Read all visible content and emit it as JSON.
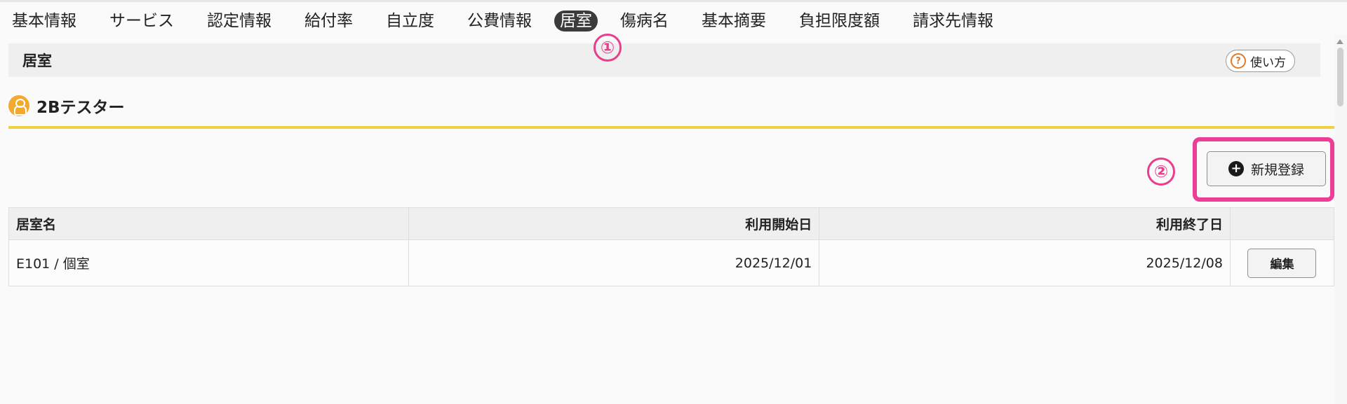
{
  "tabs": [
    {
      "label": "基本情報",
      "active": false
    },
    {
      "label": "サービス",
      "active": false
    },
    {
      "label": "認定情報",
      "active": false
    },
    {
      "label": "給付率",
      "active": false
    },
    {
      "label": "自立度",
      "active": false
    },
    {
      "label": "公費情報",
      "active": false
    },
    {
      "label": "居室",
      "active": true
    },
    {
      "label": "傷病名",
      "active": false
    },
    {
      "label": "基本摘要",
      "active": false
    },
    {
      "label": "負担限度額",
      "active": false
    },
    {
      "label": "請求先情報",
      "active": false
    }
  ],
  "annotations": {
    "one": "①",
    "two": "②"
  },
  "section": {
    "title": "居室",
    "help_label": "使い方",
    "help_icon": "question-icon"
  },
  "user": {
    "name": "2Bテスター",
    "icon": "person-icon"
  },
  "actions": {
    "new_label": "新規登録",
    "new_icon": "plus-circle-icon"
  },
  "table": {
    "headers": [
      "居室名",
      "利用開始日",
      "利用終了日",
      ""
    ],
    "rows": [
      {
        "room": "E101 / 個室",
        "start": "2025/12/01",
        "end": "2025/12/08",
        "edit_label": "編集"
      }
    ]
  },
  "colors": {
    "accent_yellow": "#f2d046",
    "annotation_pink": "#ee3d96",
    "user_icon": "#f3a92f",
    "active_tab_bg": "#3b3b3b"
  }
}
